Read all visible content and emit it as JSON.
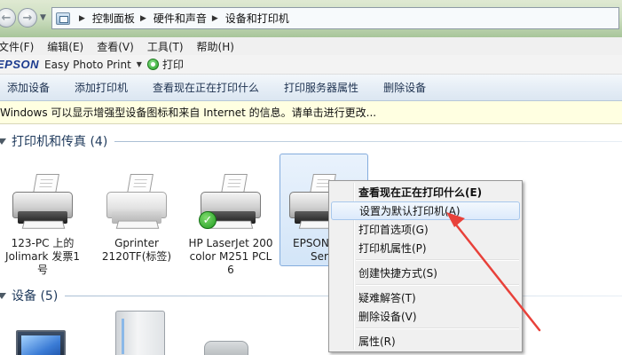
{
  "address_bar": {
    "breadcrumbs": [
      "控制面板",
      "硬件和声音",
      "设备和打印机"
    ]
  },
  "menubar": {
    "items": [
      "文件(F)",
      "编辑(E)",
      "查看(V)",
      "工具(T)",
      "帮助(H)"
    ]
  },
  "epson_bar": {
    "brand": "EPSON",
    "app": "Easy Photo Print",
    "print": "打印"
  },
  "toolbar": {
    "items": [
      "添加设备",
      "添加打印机",
      "查看现在正在打印什么",
      "打印服务器属性",
      "删除设备"
    ]
  },
  "infobar": {
    "text": "Windows 可以显示增强型设备图标和来自 Internet 的信息。请单击进行更改..."
  },
  "groups": {
    "printers": {
      "title": "打印机和传真 (4)",
      "items": [
        {
          "label": "123-PC 上的 Jolimark 发票1号",
          "default": false
        },
        {
          "label": "Gprinter 2120TF(标签)",
          "default": false
        },
        {
          "label": "HP LaserJet 200 color M251 PCL 6",
          "default": true
        },
        {
          "label": "EPSON Seri",
          "label_line1": "EPSON",
          "label_line2": "Seri",
          "default": false,
          "selected": true
        }
      ]
    },
    "devices": {
      "title": "设备 (5)"
    }
  },
  "context_menu": {
    "items": [
      {
        "label": "查看现在正在打印什么(E)",
        "bold": true
      },
      {
        "label": "设置为默认打印机(A)",
        "highlighted": true
      },
      {
        "label": "打印首选项(G)"
      },
      {
        "label": "打印机属性(P)"
      },
      {
        "label": "创建快捷方式(S)"
      },
      {
        "label": "疑难解答(T)"
      },
      {
        "label": "删除设备(V)"
      },
      {
        "label": "属性(R)"
      }
    ]
  },
  "colors": {
    "annotation_arrow": "#e8413a",
    "group_title": "#1e395b",
    "infobar_bg": "#ffffe1",
    "selection_border": "#84acdd"
  }
}
